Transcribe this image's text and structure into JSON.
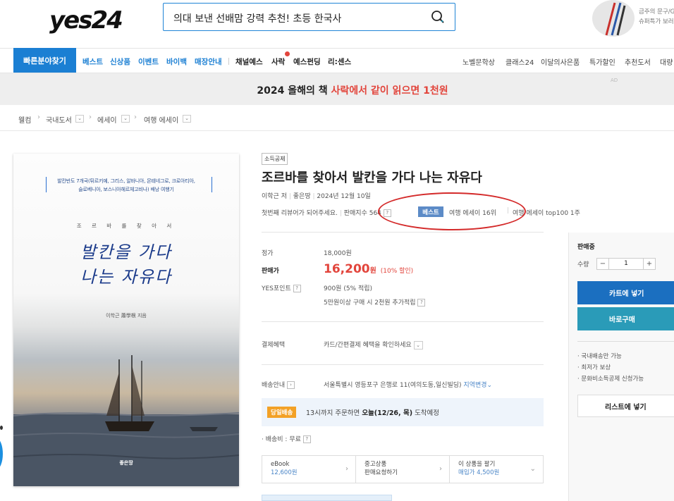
{
  "header": {
    "logo": "yes24",
    "search_text": "의대 보낸 선배맘 강력 추천! 초등 한국사",
    "ad_lines": [
      "금주의 문구/G",
      "슈퍼특가 보러"
    ]
  },
  "gnb": {
    "quick_button": "빠른분야찾기",
    "items_blue": [
      "베스트",
      "신상품",
      "이벤트",
      "바이백",
      "매장안내"
    ],
    "items_dark": [
      "채널예스",
      "사락",
      "예스펀딩",
      "리:센스"
    ],
    "items_right": [
      "노벨문학상",
      "클래스24",
      "이달의사은품",
      "특가할인",
      "추천도서",
      "대량"
    ]
  },
  "banner": {
    "text_plain": "2024 올해의 책 ",
    "text_highlight": "사락에서 같이 읽으면 1천원",
    "ad_mark": "AD"
  },
  "breadcrumb": [
    "웰컴",
    "국내도서",
    "에세이",
    "여행 에세이"
  ],
  "cover": {
    "top_line1": "발칸반도 7개국(튀르키예, 그리스, 알바니아, 몬테네그로, 크로아티아,",
    "top_line2": "슬로베니아, 보스니아헤르체고비나) 배낭 여행기",
    "sub": "조 르 바 를   찾 아 서",
    "title1": "발칸을 가다",
    "title2": "나는 자유다",
    "author": "이학근 蕭學根 지음",
    "publisher": "좋은땅"
  },
  "product": {
    "tag": "소득공제",
    "title": "조르바를 찾아서 발칸을 가다 나는 자유다",
    "author": "이학근 저",
    "publisher": "좋은땅",
    "date": "2024년 12월 10일",
    "review_prompt": "첫번째 리뷰어가 되어주세요.",
    "sales_index": "판매지수 564",
    "best_badge": "베스트",
    "rank1": "여행 에세이 16위",
    "rank2": "여행 에세이 top100 1주"
  },
  "price": {
    "list_label": "정가",
    "list_value": "18,000원",
    "sale_label": "판매가",
    "sale_value": "16,200",
    "sale_unit": "원",
    "discount": "(10% 할인)",
    "point_label": "YES포인트",
    "point_value": "900원 (5% 적립)",
    "point_extra": "5만원이상 구매 시 2천원 추가적립"
  },
  "benefit": {
    "label": "결제혜택",
    "value": "카드/간편결제 혜택을 확인하세요"
  },
  "delivery": {
    "label": "배송안내",
    "address": "서울특별시 영등포구 은행로 11(여의도동,일신빌딩)",
    "change": "지역변경",
    "badge": "당일배송",
    "eta_prefix": "13시까지 주문하면 ",
    "eta_bold": "오늘(12/26, 목)",
    "eta_suffix": " 도착예정",
    "fee": "배송비 : 무료"
  },
  "options": [
    {
      "title": "eBook",
      "sub": "12,600원"
    },
    {
      "title": "중고상품",
      "sub": "판매요청하기"
    },
    {
      "title": "이 상품을 팔기",
      "sub": "매입가 4,500원"
    }
  ],
  "sidebar": {
    "status": "판매중",
    "qty_label": "수량",
    "qty_value": "1",
    "minus": "−",
    "plus": "+",
    "cart": "카트에 넣기",
    "buy": "바로구매",
    "notes": [
      "국내배송만 가능",
      "최저가 보상",
      "문화비소득공제 신청가능"
    ],
    "wish": "리스트에 넣기"
  },
  "colors": {
    "brand_blue": "#1b7fd3",
    "sale_red": "#e2453c",
    "cart_blue": "#1b6fc0",
    "buy_teal": "#2a9bb8",
    "annotation_red": "#d42a2a"
  }
}
